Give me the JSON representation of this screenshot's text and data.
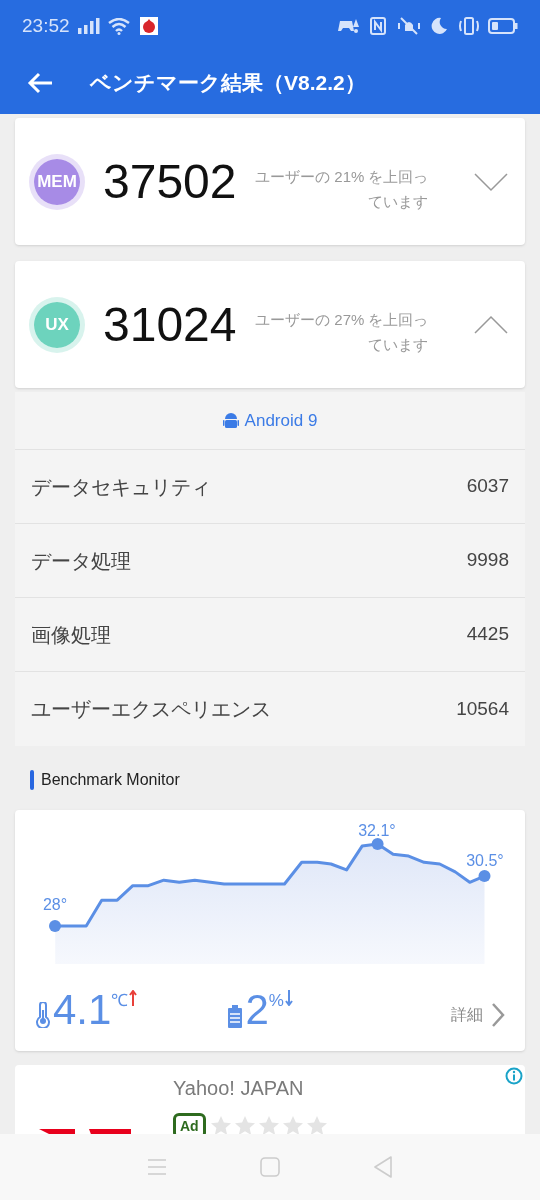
{
  "status_bar": {
    "time": "23:52"
  },
  "app_bar": {
    "title": "ベンチマーク結果（V8.2.2）"
  },
  "score_cards": [
    {
      "badge": "MEM",
      "color": "#a78be6",
      "score": "37502",
      "comparison": "ユーザーの 21% を上回っています",
      "expanded": false
    },
    {
      "badge": "UX",
      "color": "#6dd3bd",
      "score": "31024",
      "comparison": "ユーザーの 27% を上回っています",
      "expanded": true
    }
  ],
  "platform": "Android 9",
  "ux_details": [
    {
      "label": "データセキュリティ",
      "score": "6037"
    },
    {
      "label": "データ処理",
      "score": "9998"
    },
    {
      "label": "画像処理",
      "score": "4425"
    },
    {
      "label": "ユーザーエクスペリエンス",
      "score": "10564"
    }
  ],
  "monitor": {
    "title": "Benchmark Monitor",
    "point_labels": [
      "28°",
      "32.1°",
      "30.5°"
    ],
    "temperature_rise": "4.1",
    "temperature_unit": "℃",
    "battery_drop": "2",
    "battery_unit": "%",
    "details_link": "詳細"
  },
  "ad": {
    "title": "Yahoo! JAPAN",
    "label": "Ad",
    "stars": 0
  }
}
